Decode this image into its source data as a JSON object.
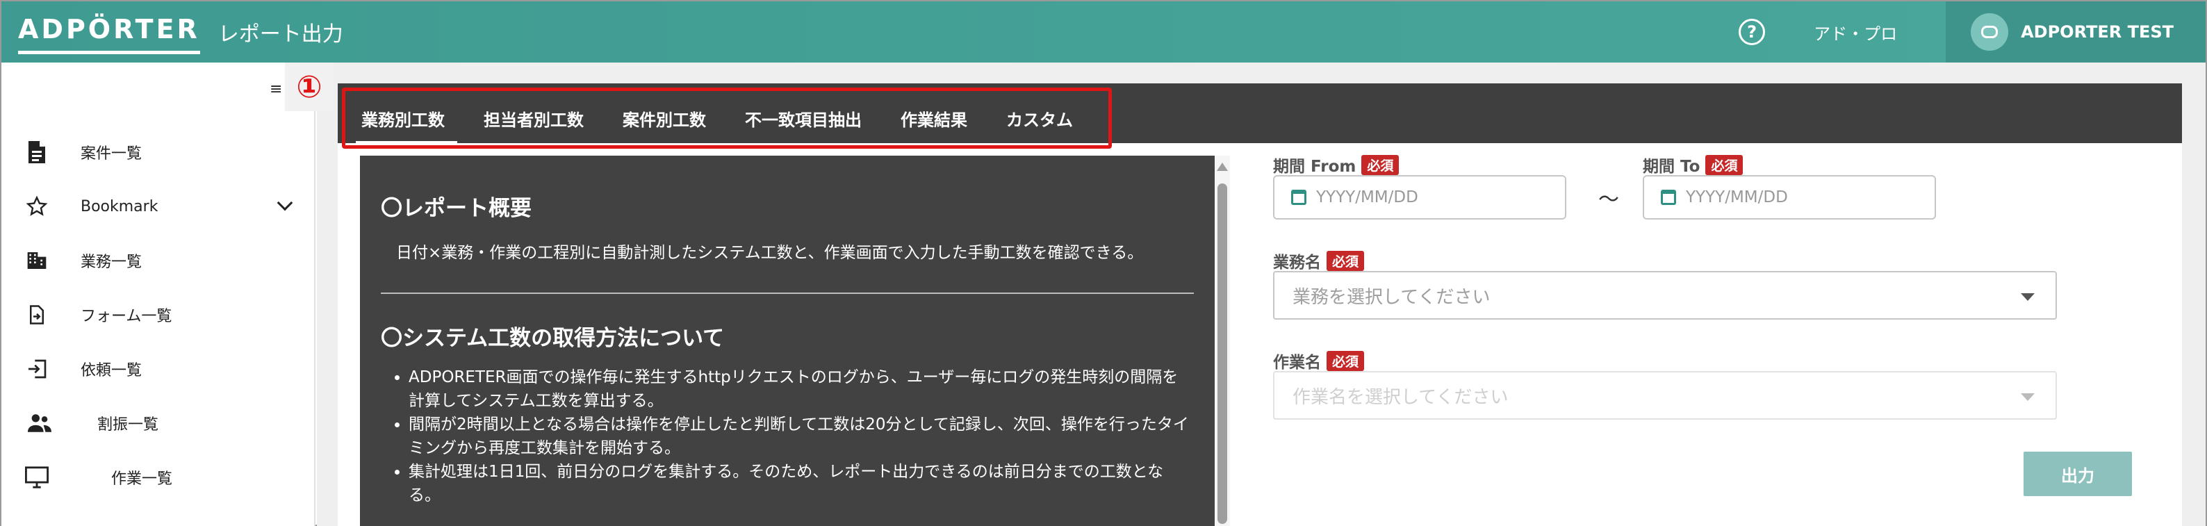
{
  "header": {
    "logo": "ADPÖRTER",
    "app_title": "レポート出力",
    "help_icon": "?",
    "user_role": "アド・プロ",
    "user_name": "ADPORTER TEST"
  },
  "annotation": {
    "marker": "①",
    "color": "#e01515"
  },
  "sidebar": {
    "toggle_icon": "≡",
    "items": [
      {
        "label": "案件一覧",
        "icon": "document-icon"
      },
      {
        "label": "Bookmark",
        "icon": "star-icon",
        "expandable": true
      },
      {
        "label": "業務一覧",
        "icon": "building-icon"
      },
      {
        "label": "フォーム一覧",
        "icon": "file-import-icon"
      },
      {
        "label": "依頼一覧",
        "icon": "login-icon"
      },
      {
        "label": "割振一覧",
        "icon": "people-icon"
      },
      {
        "label": "作業一覧",
        "icon": "monitor-icon"
      }
    ]
  },
  "tabs": [
    {
      "label": "業務別工数",
      "active": true
    },
    {
      "label": "担当者別工数"
    },
    {
      "label": "案件別工数"
    },
    {
      "label": "不一致項目抽出"
    },
    {
      "label": "作業結果"
    },
    {
      "label": "カスタム"
    }
  ],
  "info": {
    "overview_title": "〇レポート概要",
    "overview_text": "日付×業務・作業の工程別に自動計測したシステム工数と、作業画面で入力した手動工数を確認できる。",
    "method_title": "〇システム工数の取得方法について",
    "method_items": [
      "ADPORETER画面での操作毎に発生するhttpリクエストのログから、ユーザー毎にログの発生時刻の間隔を計算してシステム工数を算出する。",
      "間隔が2時間以上となる場合は操作を停止したと判断して工数は20分として記録し、次回、操作を行ったタイミングから再度工数集計を開始する。",
      "集計処理は1日1回、前日分のログを集計する。そのため、レポート出力できるのは前日分までの工数となる。"
    ]
  },
  "form": {
    "period_from_label": "期間 From",
    "period_to_label": "期間 To",
    "required_badge": "必須",
    "date_placeholder": "YYYY/MM/DD",
    "range_separator": "～",
    "business_label": "業務名",
    "business_placeholder": "業務を選択してください",
    "task_label": "作業名",
    "task_placeholder": "作業名を選択してください",
    "output_button": "出力"
  },
  "colors": {
    "header": "#45a397",
    "tabbar": "#3f3f3f",
    "required": "#c62828",
    "button": "#8cc1bd"
  }
}
